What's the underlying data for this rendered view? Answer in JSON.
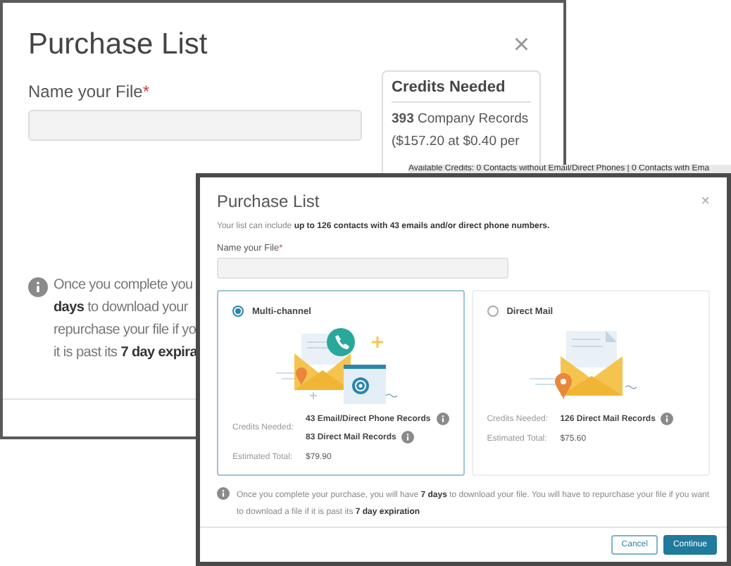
{
  "back_dialog": {
    "title": "Purchase List",
    "close": "×",
    "file_field": {
      "label": "Name your File",
      "required_mark": "*"
    },
    "credits_card": {
      "title": "Credits Needed",
      "count": "393",
      "count_label": "Company Records",
      "price_line": "($157.20 at $0.40 per"
    },
    "notice_lines": [
      "Once you complete you",
      "**days** to download your",
      "repurchase your file if yo",
      "it is past its **7 day expira**"
    ]
  },
  "available_credits": "Available Credits: 0 Contacts without Email/Direct Phones | 0 Contacts with Ema",
  "front_dialog": {
    "title": "Purchase List",
    "close": "×",
    "intro": "Your list can include **up to 126 contacts with 43 emails and/or direct phone numbers.**",
    "file_field": {
      "label": "Name your File",
      "required_mark": "*"
    },
    "options": [
      {
        "name": "Multi-channel",
        "selected": true,
        "kind": "multichannel",
        "credits_label": "Credits Needed:",
        "credits": [
          "43 Email/Direct Phone Records",
          "83 Direct Mail Records"
        ],
        "total_label": "Estimated Total:",
        "total": "$79.90"
      },
      {
        "name": "Direct Mail",
        "selected": false,
        "kind": "mail",
        "credits_label": "Credits Needed:",
        "credits": [
          "126 Direct Mail Records"
        ],
        "total_label": "Estimated Total:",
        "total": "$75.60"
      }
    ],
    "notice": "Once you complete your purchase, you will have **7 days** to download your file. You will have to repurchase your file if you want to download a file if it is past its **7 day expiration**",
    "buttons": [
      {
        "label": "Cancel",
        "kind": "secondary"
      },
      {
        "label": "Continue",
        "kind": "primary"
      }
    ]
  }
}
